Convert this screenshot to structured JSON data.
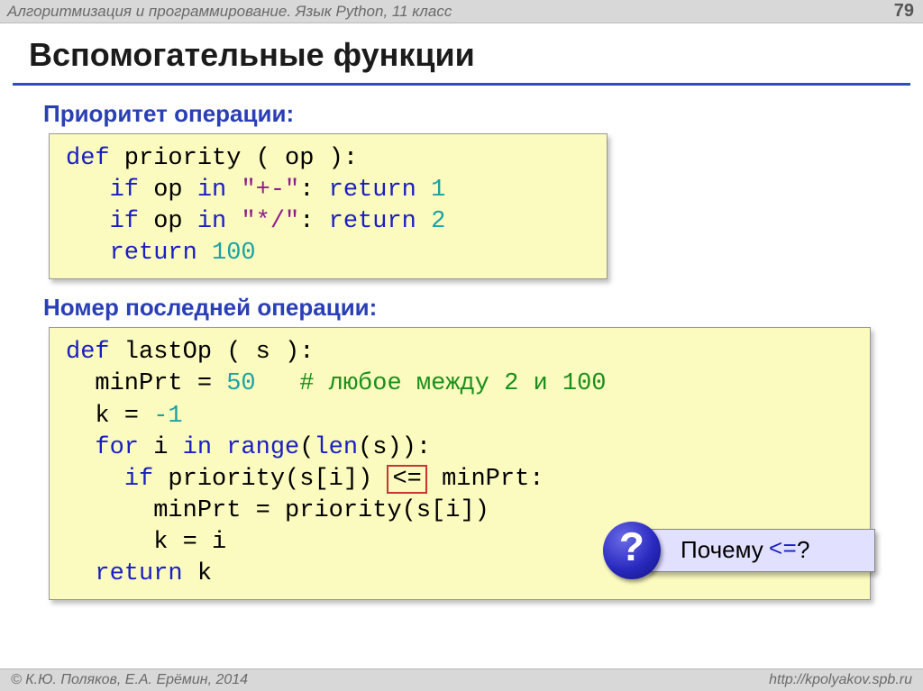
{
  "header": {
    "course": "Алгоритмизация и программирование. Язык Python, 11 класс",
    "page": "79"
  },
  "title": "Вспомогательные функции",
  "section1": "Приоритет операции:",
  "code1": {
    "l1": {
      "kw1": "def",
      "fn": " priority ( op ):"
    },
    "l2": {
      "indent": "   ",
      "kw1": "if",
      "mid": " op ",
      "kw2": "in",
      "sp": " ",
      "str": "\"+-\"",
      "colon": ": ",
      "kw3": "return",
      "sp2": " ",
      "num": "1"
    },
    "l3": {
      "indent": "   ",
      "kw1": "if",
      "mid": " op ",
      "kw2": "in",
      "sp": " ",
      "str": "\"*/\"",
      "colon": ": ",
      "kw3": "return",
      "sp2": " ",
      "num": "2"
    },
    "l4": {
      "indent": "   ",
      "kw1": "return",
      "sp": " ",
      "num": "100"
    }
  },
  "section2": "Номер последней операции:",
  "code2": {
    "l1": {
      "kw1": "def",
      "fn": " lastOp ( s ):"
    },
    "l2": {
      "indent": "  ",
      "var": "minPrt = ",
      "num": "50",
      "pad": "   ",
      "comment": "# любое между 2 и 100"
    },
    "l3": {
      "indent": "  ",
      "var": "k = ",
      "num": "-1"
    },
    "l4": {
      "indent": "  ",
      "kw1": "for",
      "mid": " i ",
      "kw2": "in",
      "sp": " ",
      "kw3": "range",
      "rest": "(",
      "kw4": "len",
      "rest2": "(s)):"
    },
    "l5": {
      "indent": "    ",
      "kw1": "if",
      "rest": " priority(s[i]) ",
      "box": "<=",
      "rest2": " minPrt:"
    },
    "l6": {
      "indent": "      ",
      "rest": "minPrt = priority(s[i])"
    },
    "l7": {
      "indent": "      ",
      "rest": "k = i"
    },
    "l8": {
      "indent": "  ",
      "kw1": "return",
      "rest": " k"
    }
  },
  "question": {
    "badge": "?",
    "text": "Почему ",
    "op": "<=",
    "q": "?"
  },
  "footer": {
    "left": "© К.Ю. Поляков, Е.А. Ерёмин, 2014",
    "right": "http://kpolyakov.spb.ru"
  }
}
